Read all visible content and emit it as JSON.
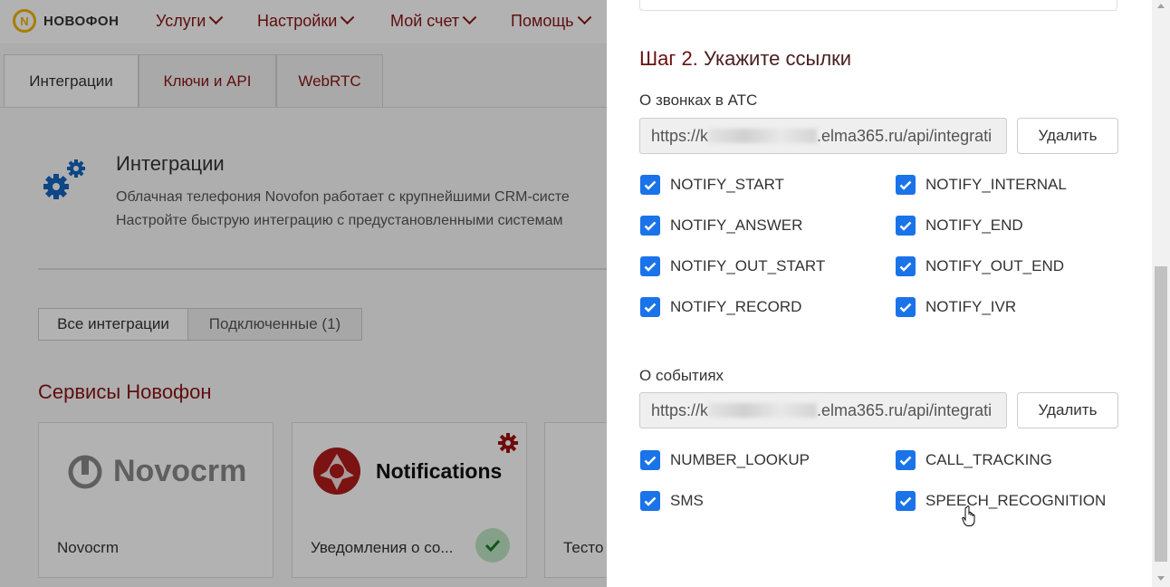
{
  "brand": {
    "logo_text": "НОВОФОН",
    "logo_letter": "N"
  },
  "topnav": {
    "items": [
      {
        "label": "Услуги"
      },
      {
        "label": "Настройки"
      },
      {
        "label": "Мой счет"
      },
      {
        "label": "Помощь"
      }
    ]
  },
  "tabs": [
    {
      "label": "Интеграции",
      "active": true
    },
    {
      "label": "Ключи и API",
      "active": false
    },
    {
      "label": "WebRTC",
      "active": false
    }
  ],
  "integrations": {
    "title": "Интеграции",
    "desc_line1": "Облачная телефония Novofon работает с крупнейшими CRM-систе",
    "desc_line2": "Настройте быструю интеграцию с предустановленными системам"
  },
  "filters": {
    "all": "Все интеграции",
    "connected": "Подключенные (1)"
  },
  "services": {
    "title": "Сервисы Новофон",
    "cards": [
      {
        "logo": "Novocrm",
        "caption": "Novocrm"
      },
      {
        "logo": "Notifications",
        "caption": "Уведомления о со..."
      },
      {
        "caption": "Тесто"
      }
    ]
  },
  "panel": {
    "step_prefix": "Шаг 2.",
    "step_title": " Укажите ссылки",
    "calls": {
      "label": "О звонках в АТС",
      "url_start": "https://k",
      "url_end": ".elma365.ru/api/integrati",
      "delete_label": "Удалить",
      "checkboxes_left": [
        "NOTIFY_START",
        "NOTIFY_ANSWER",
        "NOTIFY_OUT_START",
        "NOTIFY_RECORD"
      ],
      "checkboxes_right": [
        "NOTIFY_INTERNAL",
        "NOTIFY_END",
        "NOTIFY_OUT_END",
        "NOTIFY_IVR"
      ]
    },
    "events": {
      "label": "О событиях",
      "url_start": "https://k",
      "url_end": ".elma365.ru/api/integrati",
      "delete_label": "Удалить",
      "checkboxes_left": [
        "NUMBER_LOOKUP",
        "SMS"
      ],
      "checkboxes_right": [
        "CALL_TRACKING",
        "SPEECH_RECOGNITION"
      ]
    }
  },
  "colors": {
    "accent": "#8a1414",
    "checkbox": "#1a73e8",
    "brand_yellow": "#f0b400"
  }
}
